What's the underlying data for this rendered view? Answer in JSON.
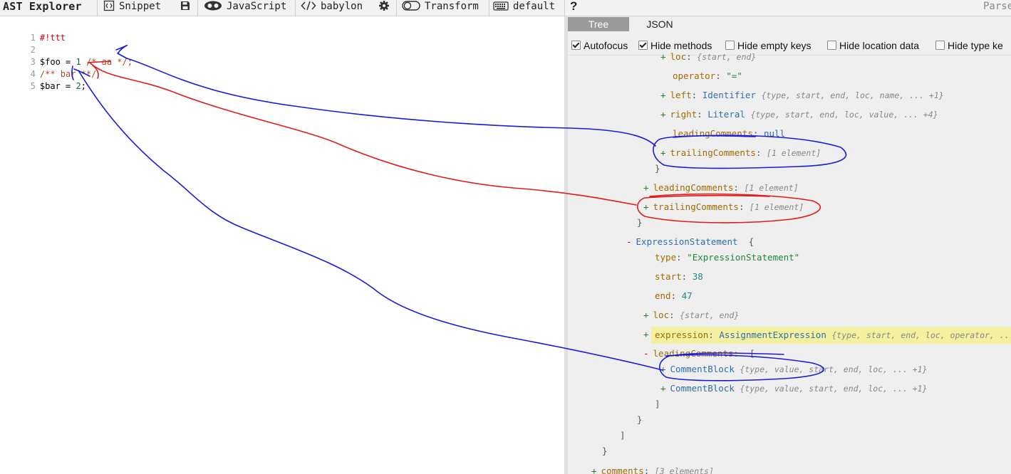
{
  "toolbar": {
    "title": "AST Explorer",
    "snippet": "Snippet",
    "language": "JavaScript",
    "parser": "babylon",
    "transform": "Transform",
    "keymap": "default",
    "help": "?",
    "parser_right": "Parse"
  },
  "editor": {
    "lines": [
      {
        "n": "1",
        "text": "#!ttt"
      },
      {
        "n": "2",
        "text": ""
      },
      {
        "n": "3",
        "a": "$foo = ",
        "b": "1",
        "c": " /* aa */;"
      },
      {
        "n": "4",
        "text": "/** bar **/"
      },
      {
        "n": "5",
        "a": "$bar = ",
        "b": "2",
        "c": ";"
      }
    ]
  },
  "tabs": {
    "tree": "Tree",
    "json": "JSON"
  },
  "options": {
    "autofocus": "Autofocus",
    "hide_methods": "Hide methods",
    "hide_empty": "Hide empty keys",
    "hide_location": "Hide location data",
    "hide_type": "Hide type ke"
  },
  "tree": {
    "loc1": {
      "key": "loc",
      "sum": "{start, end}"
    },
    "operator": {
      "key": "operator",
      "val": "\"=\""
    },
    "left": {
      "key": "left",
      "type": "Identifier",
      "sum": "{type, start, end, loc, name, ... +1}"
    },
    "right": {
      "key": "right",
      "type": "Literal",
      "sum": "{type, start, end, loc, value, ... +4}"
    },
    "leading_null": {
      "key": "leadingComments",
      "val": "null"
    },
    "trailing_inner": {
      "key": "trailingComments",
      "sum": "[1 element]"
    },
    "close1": "}",
    "leading_outer": {
      "key": "leadingComments",
      "sum": "[1 element]"
    },
    "trailing_outer": {
      "key": "trailingComments",
      "sum": "[1 element]"
    },
    "close2": "}",
    "expr_stmt": {
      "type": "ExpressionStatement",
      "brace": "{"
    },
    "type_line": {
      "key": "type",
      "val": "\"ExpressionStatement\""
    },
    "start_line": {
      "key": "start",
      "val": "38"
    },
    "end_line": {
      "key": "end",
      "val": "47"
    },
    "loc2": {
      "key": "loc",
      "sum": "{start, end}"
    },
    "expression": {
      "key": "expression",
      "type": "AssignmentExpression",
      "sum": "{type, start, end, loc, operator, ..."
    },
    "leading_list": {
      "key": "leadingComments",
      "brace": "["
    },
    "cb1": {
      "type": "CommentBlock",
      "sum": "{type, value, start, end, loc, ... +1}"
    },
    "cb2": {
      "type": "CommentBlock",
      "sum": "{type, value, start, end, loc, ... +1}"
    },
    "close_bracket": "]",
    "close3": "}",
    "close_bracket2": "]",
    "close4": "}",
    "comments": {
      "key": "comments",
      "sum": "[3 elements]"
    }
  }
}
